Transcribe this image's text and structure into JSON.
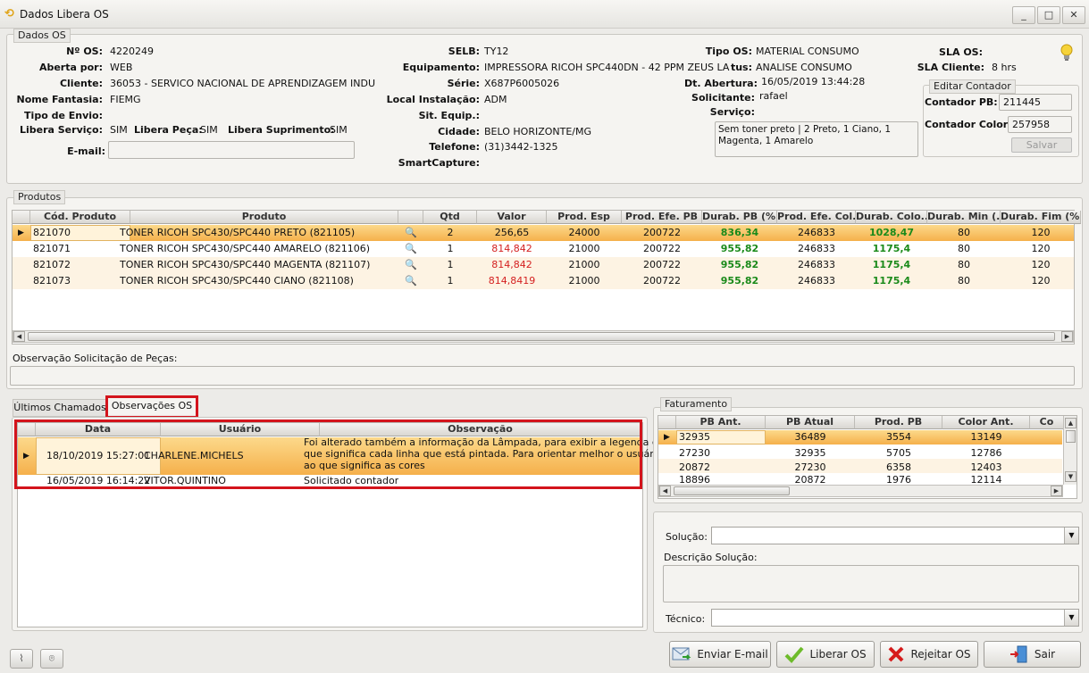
{
  "window": {
    "title": "Dados Libera OS",
    "min": "_",
    "max": "□",
    "close": "✕"
  },
  "dados_os": {
    "legend": "Dados OS",
    "nos_label": "Nº OS:",
    "nos": "4220249",
    "aberta_label": "Aberta por:",
    "aberta": "WEB",
    "cliente_label": "Cliente:",
    "cliente": "36053 - SERVICO NACIONAL DE APRENDIZAGEM INDU",
    "fantasia_label": "Nome Fantasia:",
    "fantasia": "FIEMG",
    "tipo_envio_label": "Tipo de Envio:",
    "lib_serv_label": "Libera Serviço:",
    "lib_serv": "SIM",
    "lib_peca_label": "Libera Peça:",
    "lib_peca": "SIM",
    "lib_supr_label": "Libera Suprimento:",
    "lib_supr": "SIM",
    "email_label": "E-mail:",
    "selb_label": "SELB:",
    "selb": "TY12",
    "equip_label": "Equipamento:",
    "equip": "IMPRESSORA RICOH SPC440DN - 42 PPM ZEUS LA",
    "serie_label": "Série:",
    "serie": "X687P6005026",
    "local_label": "Local Instalação:",
    "local": "ADM",
    "sit_label": "Sit. Equip.:",
    "cidade_label": "Cidade:",
    "cidade": "BELO HORIZONTE/MG",
    "tel_label": "Telefone:",
    "tel": "(31)3442-1325",
    "smart_label": "SmartCapture:",
    "tipo_os_label": "Tipo OS:",
    "tipo_os": "MATERIAL CONSUMO",
    "status_label": "tus:",
    "status": "ANALISE CONSUMO",
    "dt_label": "Dt. Abertura:",
    "dt": "16/05/2019 13:44:28",
    "solic_label": "Solicitante:",
    "solic": "rafael",
    "servico_label": "Serviço:",
    "servico": "Sem toner preto | 2 Preto, 1 Ciano, 1 Magenta, 1 Amarelo",
    "sla_os_label": "SLA OS:",
    "sla_cli_label": "SLA Cliente:",
    "sla_cli": "8 hrs",
    "editar": {
      "legend": "Editar Contador",
      "pb_label": "Contador PB:",
      "pb": "211445",
      "color_label": "Contador Color:",
      "color": "257958",
      "salvar": "Salvar"
    }
  },
  "produtos": {
    "legend": "Produtos",
    "headers": [
      "Cód. Produto",
      "Produto",
      "",
      "Qtd",
      "Valor",
      "Prod. Esp",
      "Prod. Efe. PB",
      "Durab. PB (%)",
      "Prod. Efe. Col...",
      "Durab. Colo...",
      "Durab. Min (...",
      "Durab. Fim (%)"
    ],
    "rows": [
      {
        "cod": "821070",
        "produto": "TONER RICOH SPC430/SPC440 PRETO (821105)",
        "qtd": "2",
        "valor": "256,65",
        "esp": "24000",
        "efe_pb": "200722",
        "dur_pb": "836,34",
        "efe_col": "246833",
        "dur_col": "1028,47",
        "min": "80",
        "fim": "120"
      },
      {
        "cod": "821071",
        "produto": "TONER RICOH SPC430/SPC440 AMARELO (821106)",
        "qtd": "1",
        "valor": "814,842",
        "esp": "21000",
        "efe_pb": "200722",
        "dur_pb": "955,82",
        "efe_col": "246833",
        "dur_col": "1175,4",
        "min": "80",
        "fim": "120"
      },
      {
        "cod": "821072",
        "produto": "TONER RICOH SPC430/SPC440 MAGENTA (821107)",
        "qtd": "1",
        "valor": "814,842",
        "esp": "21000",
        "efe_pb": "200722",
        "dur_pb": "955,82",
        "efe_col": "246833",
        "dur_col": "1175,4",
        "min": "80",
        "fim": "120"
      },
      {
        "cod": "821073",
        "produto": "TONER RICOH SPC430/SPC440 CIANO (821108)",
        "qtd": "1",
        "valor": "814,8419",
        "esp": "21000",
        "efe_pb": "200722",
        "dur_pb": "955,82",
        "efe_col": "246833",
        "dur_col": "1175,4",
        "min": "80",
        "fim": "120"
      }
    ]
  },
  "obs_pecas_label": "Observação Solicitação de Peças:",
  "tabs": {
    "ultimos": "Últimos Chamados",
    "obs": "Observações OS"
  },
  "obs": {
    "headers": [
      "Data",
      "Usuário",
      "Observação"
    ],
    "rows": [
      {
        "data": "18/10/2019 15:27:01",
        "usuario": "CHARLENE.MICHELS",
        "obs1": "Foi alterado também a informação da Lâmpada, para exibir a legenda do",
        "obs2": "que significa cada linha que está pintada. Para orientar melhor o usuário",
        "obs3": "ao que significa as cores"
      },
      {
        "data": "16/05/2019 16:14:22",
        "usuario": "VITOR.QUINTINO",
        "obs1": "Solicitado contador"
      }
    ]
  },
  "faturamento": {
    "legend": "Faturamento",
    "headers": [
      "PB Ant.",
      "PB Atual",
      "Prod. PB",
      "Color Ant.",
      "Co"
    ],
    "rows": [
      [
        "32935",
        "36489",
        "3554",
        "13149"
      ],
      [
        "27230",
        "32935",
        "5705",
        "12786"
      ],
      [
        "20872",
        "27230",
        "6358",
        "12403"
      ],
      [
        "18896",
        "20872",
        "1976",
        "12114"
      ]
    ]
  },
  "solucao": {
    "solucao_label": "Solução:",
    "desc_label": "Descrição Solução:",
    "tecnico_label": "Técnico:"
  },
  "buttons": {
    "email": "Enviar E-mail",
    "liberar": "Liberar OS",
    "rejeitar": "Rejeitar OS",
    "sair": "Sair"
  },
  "colors": {
    "selected_row": "#f5b04b",
    "highlight": "#d3141c",
    "green_value": "#1a8a1a",
    "red_value": "#d42020"
  }
}
